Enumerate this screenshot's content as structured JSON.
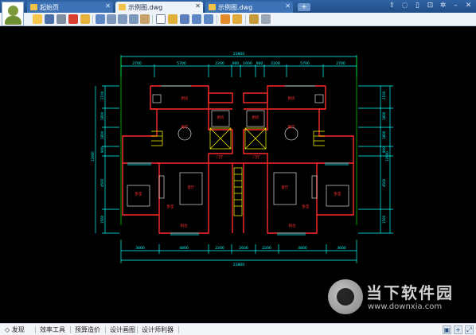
{
  "tabs": [
    {
      "label": "起始页"
    },
    {
      "label": "示例图.dwg"
    },
    {
      "label": "示例图.dwg"
    }
  ],
  "tab_add_label": "+",
  "window_controls": [
    "share-icon",
    "chat-icon",
    "device-icon",
    "lock-icon",
    "settings-icon",
    "minimize-icon",
    "close-icon"
  ],
  "toolbar": {
    "icons": [
      "open-icon",
      "save-icon",
      "print-icon",
      "pdf-icon",
      "lock-icon",
      "rotate-icon",
      "zoom-window-icon",
      "zoom-in-icon",
      "zoom-out-icon",
      "pan-icon",
      "text-icon",
      "pen-icon",
      "marker-icon",
      "undo-icon",
      "redo-icon",
      "export-icon",
      "layers-icon",
      "stack-icon",
      "check-icon"
    ]
  },
  "drawing": {
    "top_dims_total": "23800",
    "top_dims": [
      "2700",
      "5700",
      "2200",
      "900",
      "1600",
      "900",
      "2200",
      "5700",
      "2700"
    ],
    "bottom_dims_total": "23800",
    "bottom_dims": [
      "3600",
      "4800",
      "2200",
      "2600",
      "2200",
      "4800",
      "3600"
    ],
    "left_dims": [
      "2100",
      "1800",
      "1800",
      "900",
      "4500",
      "1500"
    ],
    "left_total": "12900",
    "right_dims": [
      "2100",
      "1800",
      "1800",
      "900",
      "4500",
      "1500"
    ],
    "right_total": "12900",
    "rooms": [
      "厨房",
      "厨房",
      "厨房",
      "厨房",
      "餐厅",
      "餐厅",
      "门厅",
      "门厅",
      "卧室",
      "客厅",
      "客厅",
      "卧室",
      "阳台",
      "阳台",
      "卧室",
      "卧室"
    ]
  },
  "watermark": {
    "title": "当下软件园",
    "url": "www.downxia.com"
  },
  "statusbar": {
    "items": [
      "发现",
      "效率工具",
      "预算造价",
      "设计画图",
      "设计师利器"
    ],
    "right_icons": [
      "layout-icon",
      "crosshair-icon",
      "expand-icon"
    ]
  },
  "colors": {
    "tab_bar": "#2f63a4",
    "toolbar": "#eef3fa",
    "canvas": "#000000",
    "wall": "#ff2a2a",
    "dimension": "#00ffff",
    "furniture": "#ffffff",
    "stair": "#ffff00",
    "grid": "#00ff00"
  }
}
